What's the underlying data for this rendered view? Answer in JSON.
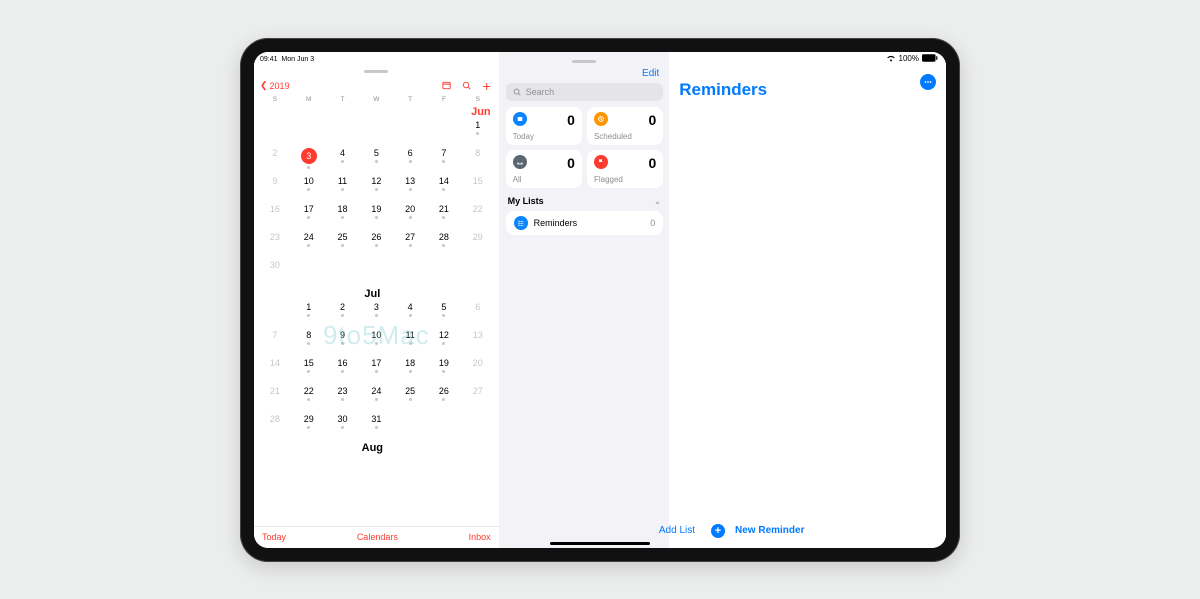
{
  "statusbar": {
    "time": "09:41",
    "date": "Mon Jun 3",
    "battery_pct": "100%"
  },
  "calendar": {
    "back_label": "2019",
    "weekdays": [
      "S",
      "M",
      "T",
      "W",
      "T",
      "F",
      "S"
    ],
    "months": {
      "jun": {
        "label": "Jun",
        "cells": [
          null,
          null,
          null,
          null,
          null,
          null,
          {
            "n": "1",
            "dot": true
          },
          {
            "n": "2",
            "dim": true
          },
          {
            "n": "3",
            "today": true,
            "dot": true
          },
          {
            "n": "4",
            "dot": true
          },
          {
            "n": "5",
            "dot": true
          },
          {
            "n": "6",
            "dot": true
          },
          {
            "n": "7",
            "dot": true
          },
          {
            "n": "8",
            "dim": true
          },
          {
            "n": "9",
            "dim": true
          },
          {
            "n": "10",
            "dot": true
          },
          {
            "n": "11",
            "dot": true
          },
          {
            "n": "12",
            "dot": true
          },
          {
            "n": "13",
            "dot": true
          },
          {
            "n": "14",
            "dot": true
          },
          {
            "n": "15",
            "dim": true
          },
          {
            "n": "16",
            "dim": true
          },
          {
            "n": "17",
            "dot": true
          },
          {
            "n": "18",
            "dot": true
          },
          {
            "n": "19",
            "dot": true
          },
          {
            "n": "20",
            "dot": true
          },
          {
            "n": "21",
            "dot": true
          },
          {
            "n": "22",
            "dim": true
          },
          {
            "n": "23",
            "dim": true
          },
          {
            "n": "24",
            "dot": true
          },
          {
            "n": "25",
            "dot": true
          },
          {
            "n": "26",
            "dot": true
          },
          {
            "n": "27",
            "dot": true
          },
          {
            "n": "28",
            "dot": true
          },
          {
            "n": "29",
            "dim": true
          },
          {
            "n": "30",
            "dim": true
          }
        ]
      },
      "jul": {
        "label": "Jul",
        "cells": [
          null,
          {
            "n": "1",
            "dot": true
          },
          {
            "n": "2",
            "dot": true
          },
          {
            "n": "3",
            "dot": true
          },
          {
            "n": "4",
            "dot": true
          },
          {
            "n": "5",
            "dot": true
          },
          {
            "n": "6",
            "dim": true
          },
          {
            "n": "7",
            "dim": true
          },
          {
            "n": "8",
            "dot": true
          },
          {
            "n": "9",
            "dot": true
          },
          {
            "n": "10",
            "dot": true
          },
          {
            "n": "11",
            "dot": true
          },
          {
            "n": "12",
            "dot": true
          },
          {
            "n": "13",
            "dim": true
          },
          {
            "n": "14",
            "dim": true
          },
          {
            "n": "15",
            "dot": true
          },
          {
            "n": "16",
            "dot": true
          },
          {
            "n": "17",
            "dot": true
          },
          {
            "n": "18",
            "dot": true
          },
          {
            "n": "19",
            "dot": true
          },
          {
            "n": "20",
            "dim": true
          },
          {
            "n": "21",
            "dim": true
          },
          {
            "n": "22",
            "dot": true
          },
          {
            "n": "23",
            "dot": true
          },
          {
            "n": "24",
            "dot": true
          },
          {
            "n": "25",
            "dot": true
          },
          {
            "n": "26",
            "dot": true
          },
          {
            "n": "27",
            "dim": true
          },
          {
            "n": "28",
            "dim": true
          },
          {
            "n": "29",
            "dot": true
          },
          {
            "n": "30",
            "dot": true
          },
          {
            "n": "31",
            "dot": true
          }
        ]
      },
      "aug": {
        "label": "Aug"
      }
    },
    "bottom": {
      "today": "Today",
      "calendars": "Calendars",
      "inbox": "Inbox"
    },
    "watermark": "9to5Mac"
  },
  "reminders": {
    "edit": "Edit",
    "search_placeholder": "Search",
    "cards": {
      "today": {
        "label": "Today",
        "count": "0"
      },
      "scheduled": {
        "label": "Scheduled",
        "count": "0"
      },
      "all": {
        "label": "All",
        "count": "0"
      },
      "flagged": {
        "label": "Flagged",
        "count": "0"
      }
    },
    "lists_header": "My Lists",
    "list": {
      "name": "Reminders",
      "count": "0"
    },
    "main_title": "Reminders",
    "add_list": "Add List",
    "new_reminder": "New Reminder"
  }
}
